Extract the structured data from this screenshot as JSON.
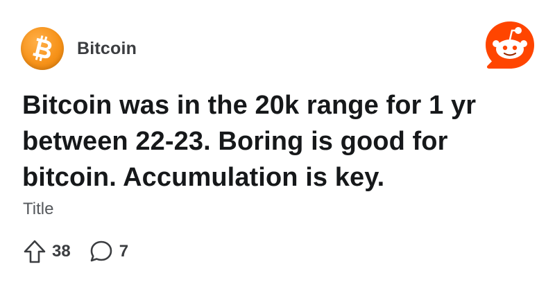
{
  "post": {
    "subreddit": "Bitcoin",
    "title": "Bitcoin was in the 20k range for 1 yr between 22-23. Boring is good for bitcoin. Accumulation is key.",
    "flair": "Title",
    "upvotes": "38",
    "comments": "7"
  },
  "icons": {
    "subreddit_avatar": "bitcoin-logo-icon",
    "brand_logo": "reddit-snoo-icon",
    "upvote": "upvote-arrow-icon",
    "comment": "comment-bubble-icon"
  },
  "colors": {
    "bitcoin_orange": "#f7931a",
    "reddit_orange": "#ff4500",
    "text_primary": "#16181a",
    "text_secondary": "#55585c"
  }
}
